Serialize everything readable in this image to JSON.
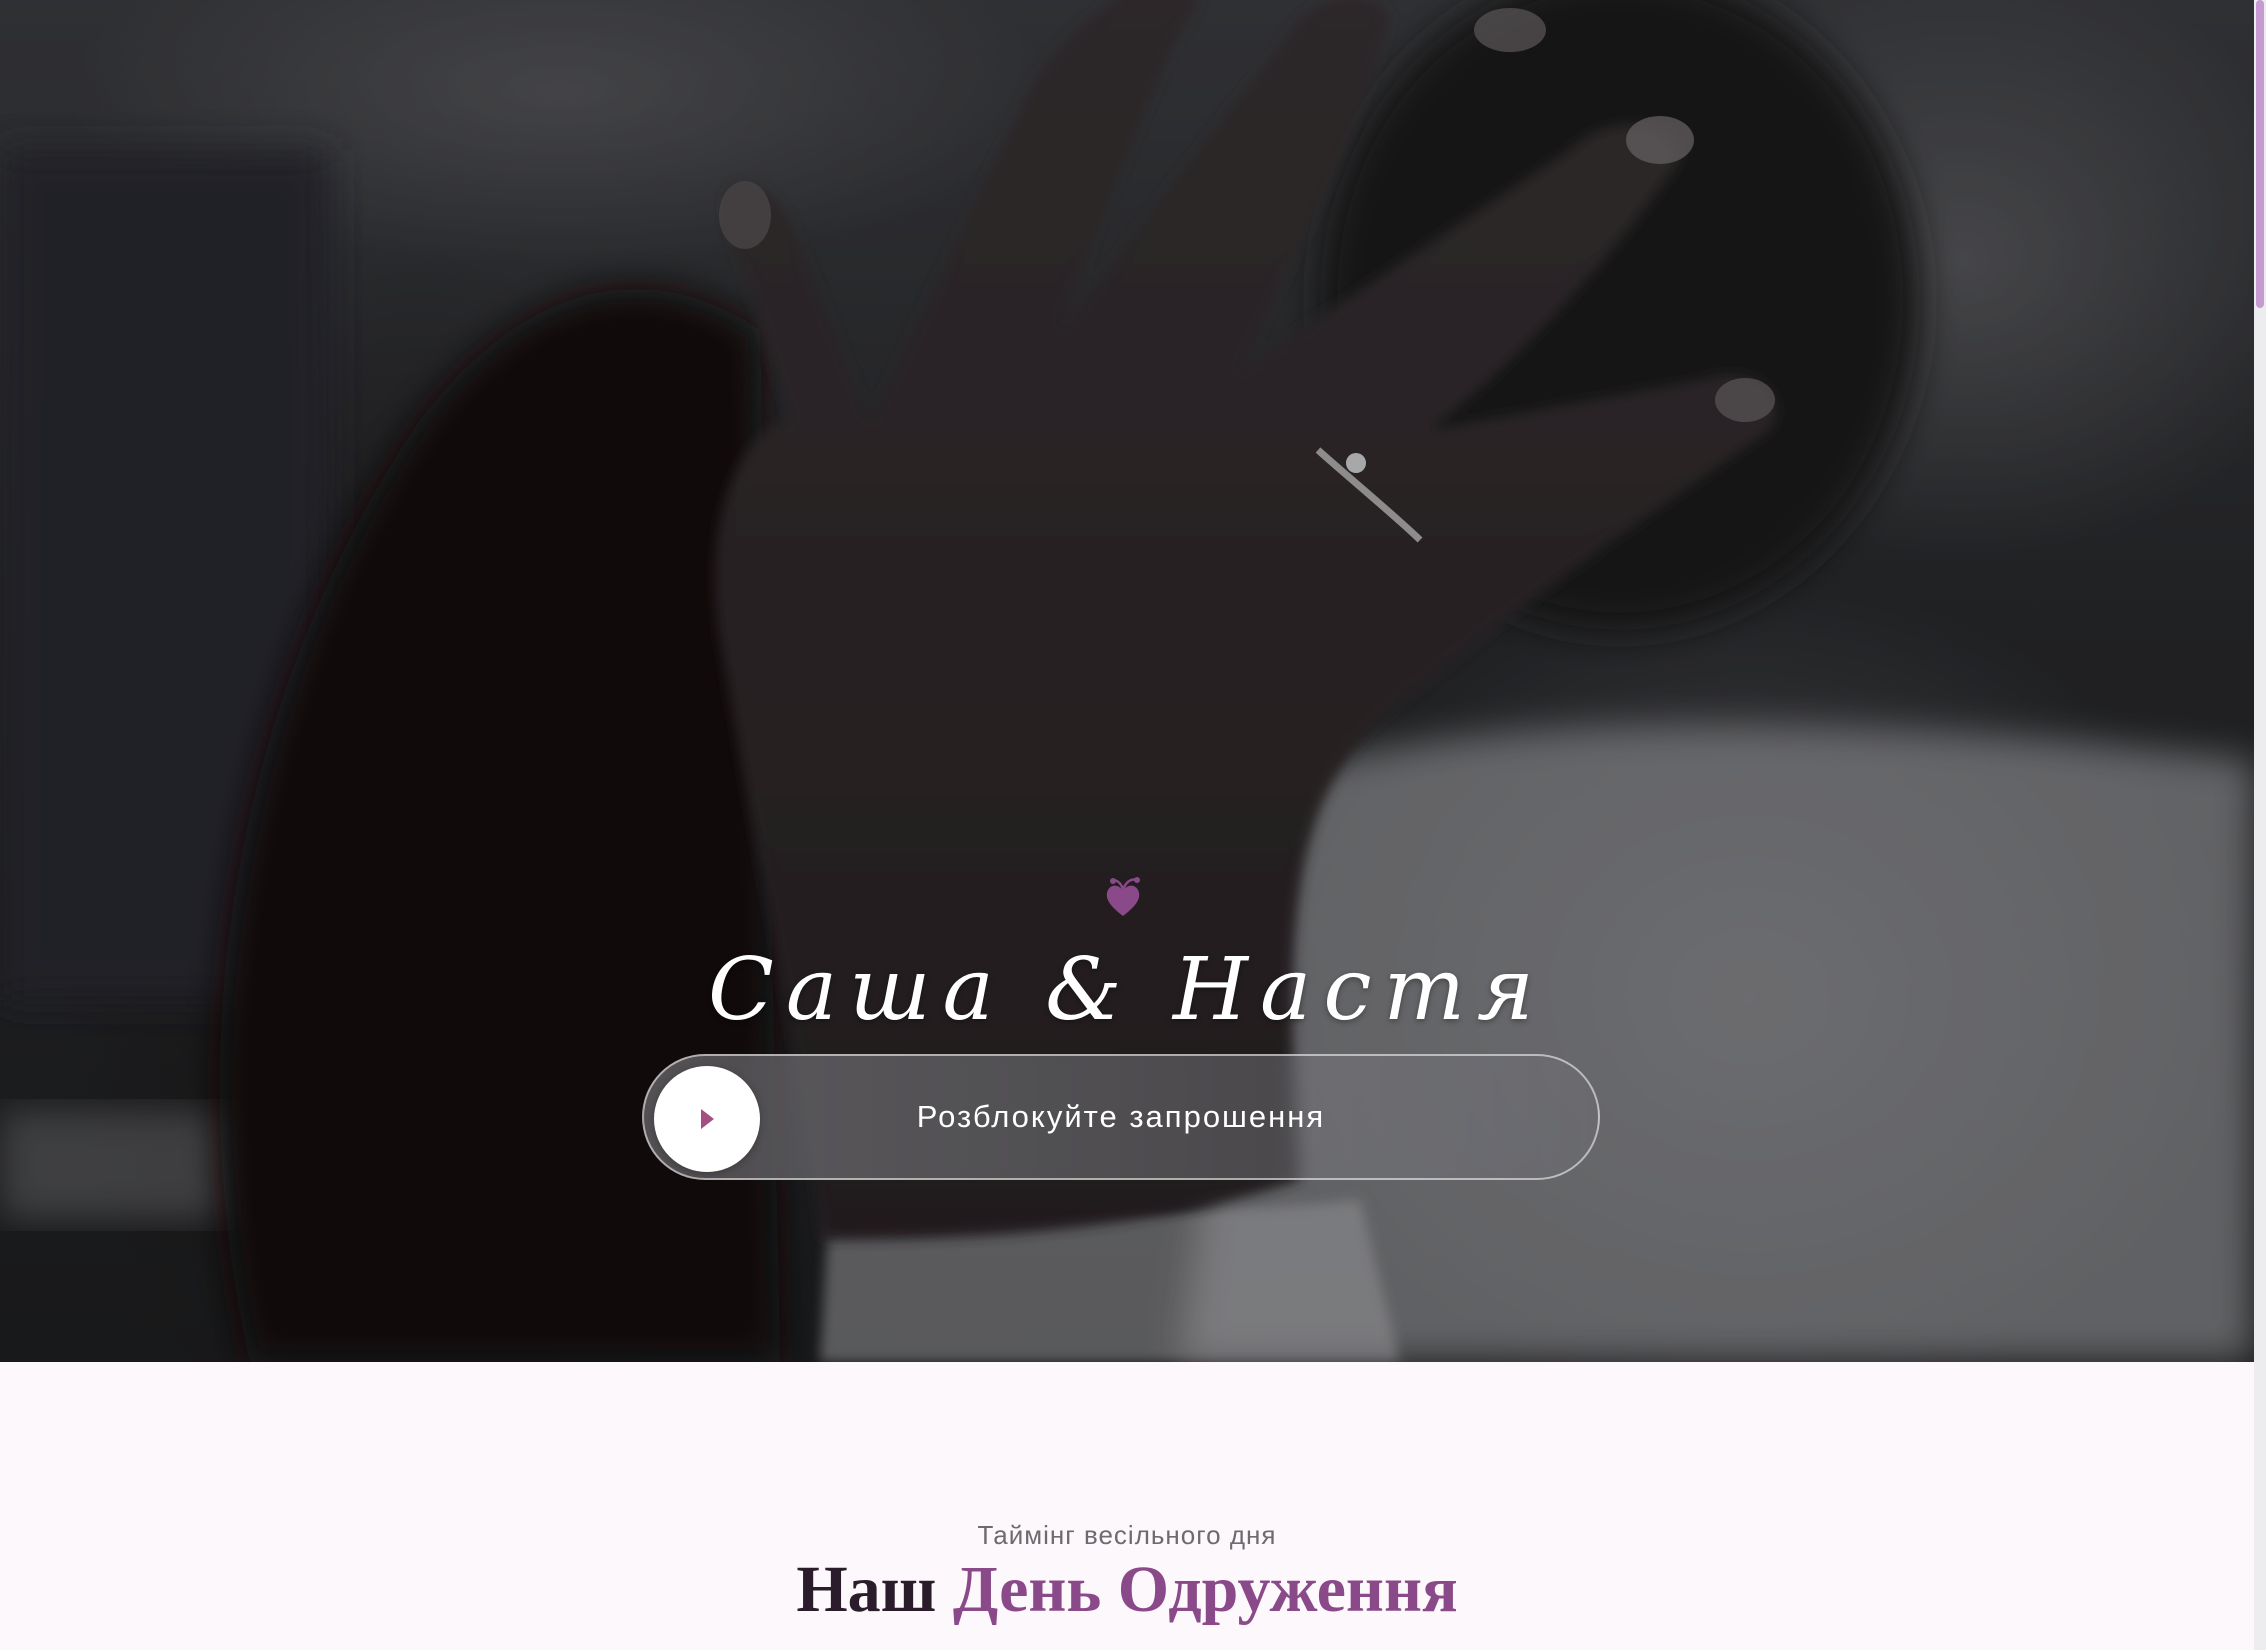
{
  "hero": {
    "couple_names": "Саша & Настя",
    "unlock": {
      "label": "Розблокуйте запрошення",
      "handle_icon": "play-icon"
    },
    "ornament_icon": "heart-icon"
  },
  "timing": {
    "eyebrow": "Таймінг весільного дня",
    "title_dark": "Наш",
    "title_accent": "День Одруження"
  },
  "colors": {
    "accent": "#8a4a8a",
    "title_dark": "#2a1c2a",
    "page_background": "#fcf8fc",
    "scroll_thumb": "#c79ad2"
  }
}
